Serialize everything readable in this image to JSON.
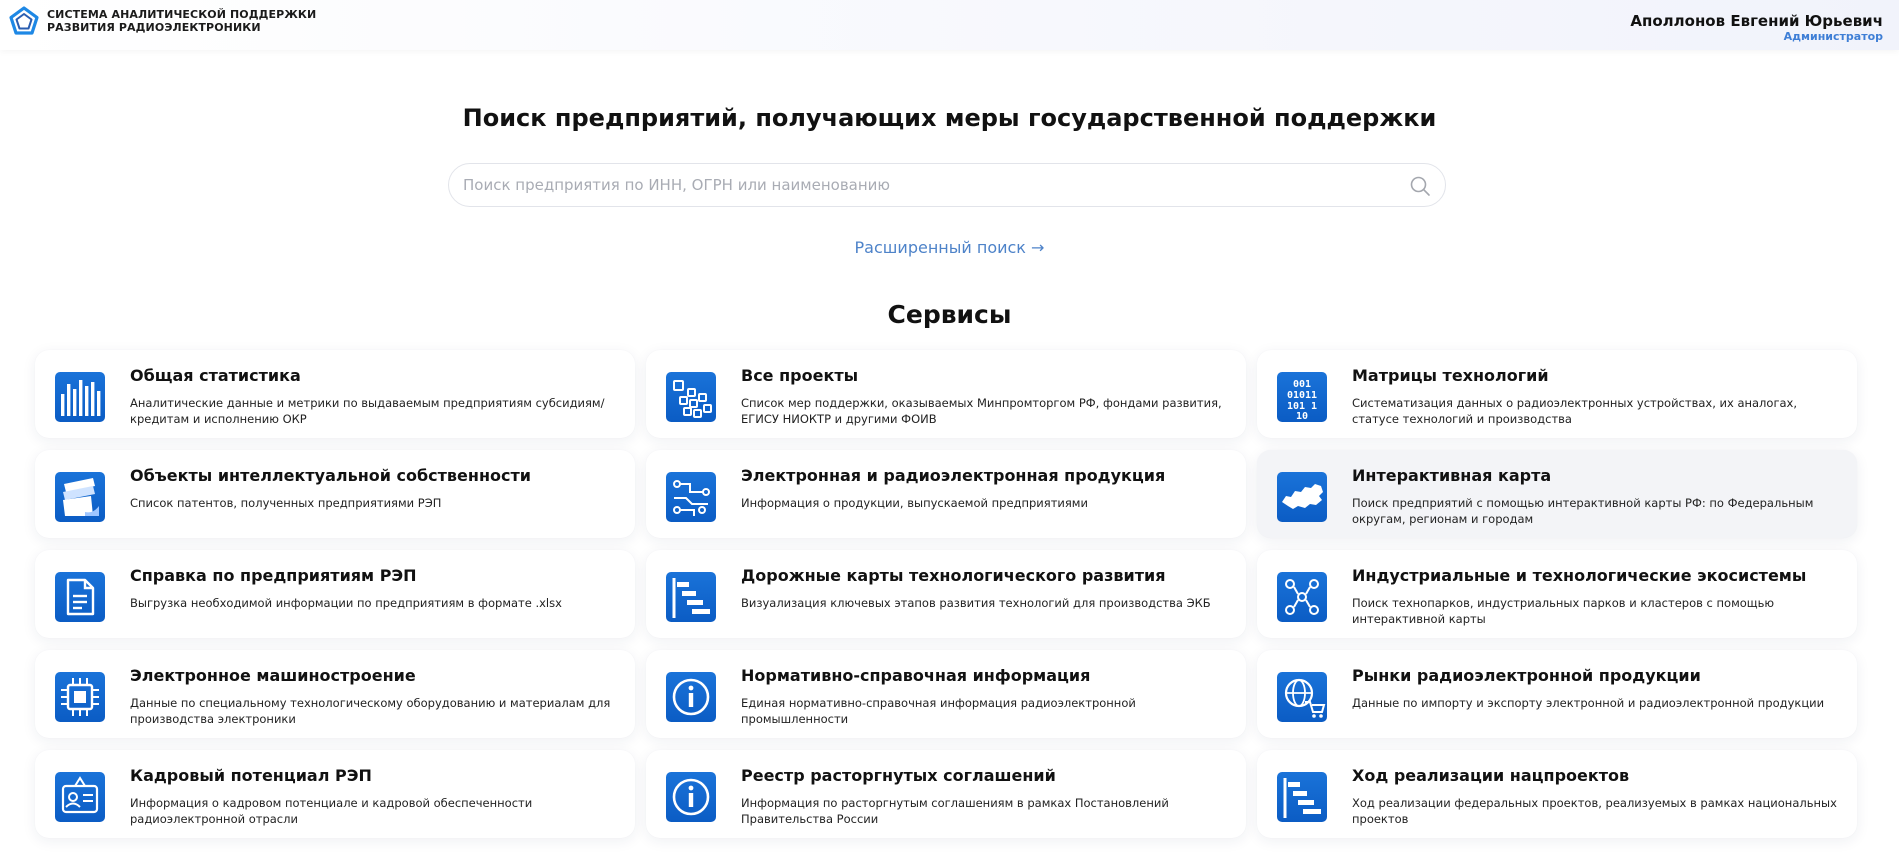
{
  "header": {
    "logo_line1": "СИСТЕМА АНАЛИТИЧЕСКОЙ ПОДДЕРЖКИ",
    "logo_line2": "РАЗВИТИЯ РАДИОЭЛЕКТРОНИКИ",
    "user_name": "Аполлонов Евгений Юрьевич",
    "user_role": "Администратор"
  },
  "main": {
    "title": "Поиск предприятий, получающих меры государственной поддержки",
    "search_placeholder": "Поиск предприятия по ИНН, ОГРН или наименованию",
    "search_value": "",
    "advanced_search": "Расширенный поиск →",
    "services_title": "Сервисы"
  },
  "colors": {
    "accent": "#4e83c9",
    "icon_blue": "#1a73d9",
    "icon_dark": "#0b5cc4"
  },
  "services": [
    {
      "title": "Общая статистика",
      "desc": "Аналитические данные и метрики по выдаваемым предприятиям субсидиям/ кредитам и исполнению ОКР",
      "icon": "bar-chart-icon"
    },
    {
      "title": "Все проекты",
      "desc": "Список мер поддержки, оказываемых Минпромторгом РФ, фондами развития, ЕГИСУ НИОКТР и другими ФОИВ",
      "icon": "grid-blocks-icon"
    },
    {
      "title": "Матрицы технологий",
      "desc": "Систематизация данных о радиоэлектронных устройствах, их аналогах, статусе технологий и производства",
      "icon": "binary-matrix-icon"
    },
    {
      "title": "Объекты интеллектуальной собственности",
      "desc": "Список патентов, полученных предприятиями РЭП",
      "icon": "documents-stack-icon"
    },
    {
      "title": "Электронная и радиоэлектронная продукция",
      "desc": "Информация о продукции, выпускаемой предприятиями",
      "icon": "circuit-icon"
    },
    {
      "title": "Интерактивная карта",
      "desc": "Поиск предприятий с помощью интерактивной карты РФ: по Федеральным округам, регионам и городам",
      "icon": "russia-map-icon"
    },
    {
      "title": "Справка по предприятиям РЭП",
      "desc": "Выгрузка необходимой информации по предприятиям в формате .xlsx",
      "icon": "document-icon"
    },
    {
      "title": "Дорожные карты технологического развития",
      "desc": "Визуализация ключевых этапов развития технологий для производства ЭКБ",
      "icon": "gantt-icon"
    },
    {
      "title": "Индустриальные и технологические экосистемы",
      "desc": "Поиск технопарков, индустриальных парков и кластеров с помощью интерактивной карты",
      "icon": "network-people-icon"
    },
    {
      "title": "Электронное машиностроение",
      "desc": "Данные по специальному технологическому оборудованию и материалам для производства электроники",
      "icon": "chip-icon"
    },
    {
      "title": "Нормативно-справочная информация",
      "desc": "Единая нормативно-справочная информация радиоэлектронной промышленности",
      "icon": "info-icon"
    },
    {
      "title": "Рынки радиоэлектронной продукции",
      "desc": "Данные по импорту и экспорту электронной и радиоэлектронной продукции",
      "icon": "globe-cart-icon"
    },
    {
      "title": "Кадровый потенциал РЭП",
      "desc": "Информация о кадровом потенциале и кадровой обеспеченности радиоэлектронной отрасли",
      "icon": "id-badge-icon"
    },
    {
      "title": "Реестр расторгнутых соглашений",
      "desc": "Информация по расторгнутым соглашениям в рамках Постановлений Правительства России",
      "icon": "info-icon"
    },
    {
      "title": "Ход реализации нацпроектов",
      "desc": "Ход реализации федеральных проектов, реализуемых в рамках национальных проектов",
      "icon": "gantt-icon"
    }
  ]
}
